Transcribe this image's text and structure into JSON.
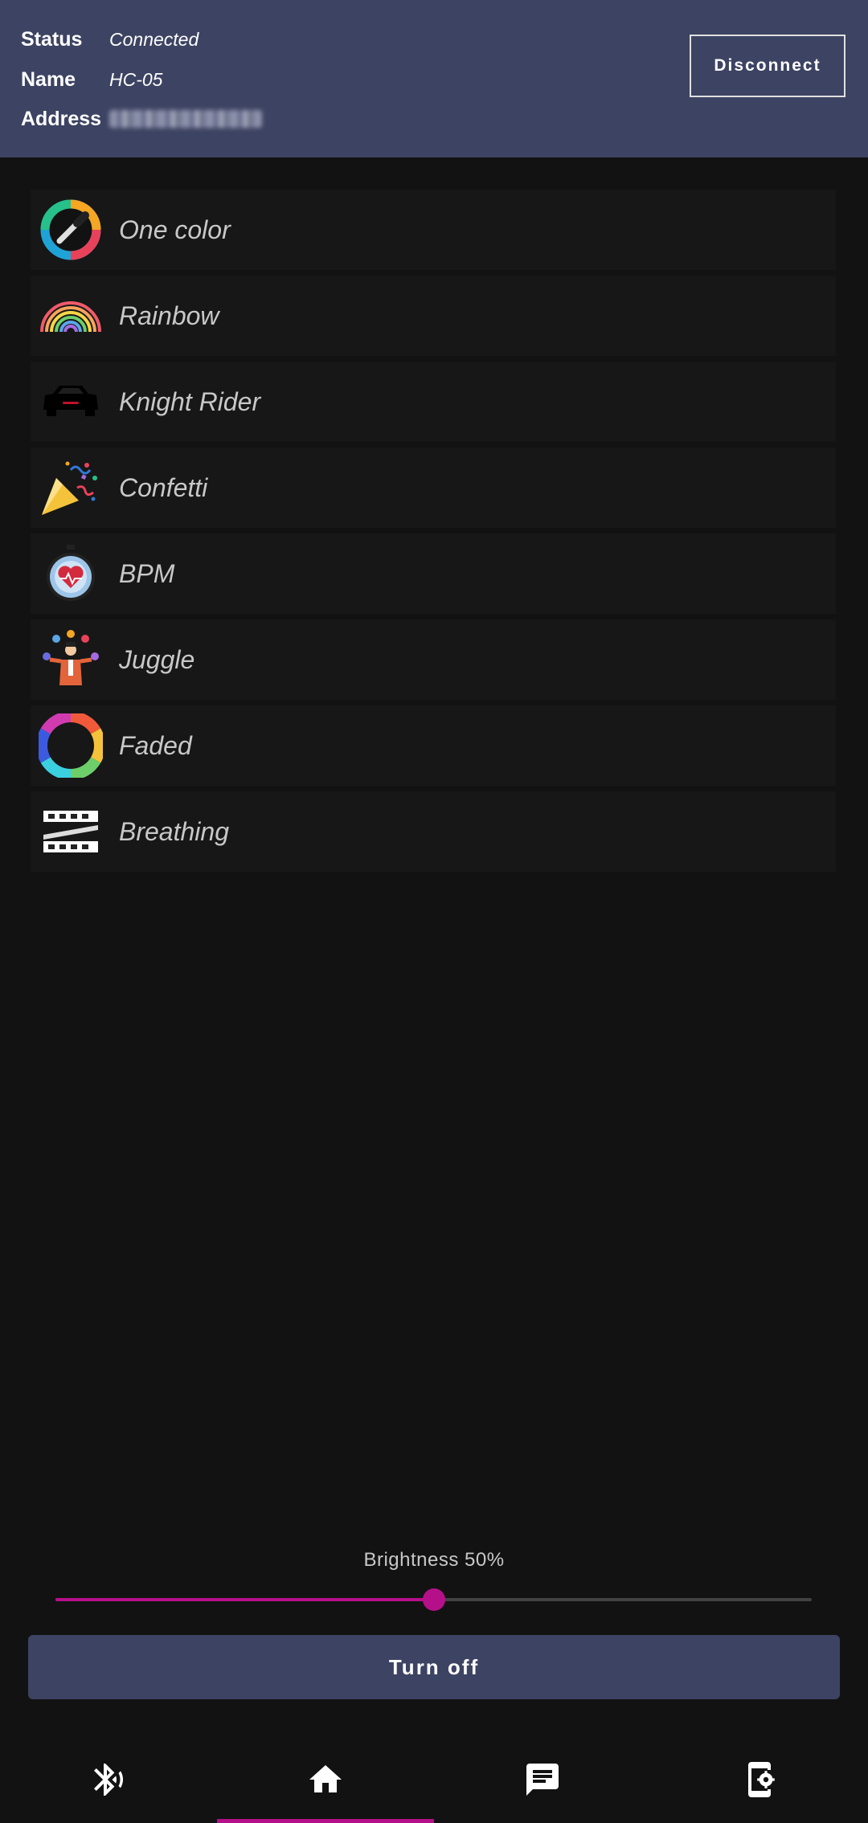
{
  "header": {
    "status_label": "Status",
    "status_value": "Connected",
    "name_label": "Name",
    "name_value": "HC-05",
    "address_label": "Address",
    "disconnect_label": "Disconnect"
  },
  "modes": [
    {
      "label": "One color",
      "icon": "color-picker-icon"
    },
    {
      "label": "Rainbow",
      "icon": "rainbow-icon"
    },
    {
      "label": "Knight Rider",
      "icon": "car-icon"
    },
    {
      "label": "Confetti",
      "icon": "party-popper-icon"
    },
    {
      "label": "BPM",
      "icon": "heart-stopwatch-icon"
    },
    {
      "label": "Juggle",
      "icon": "juggler-icon"
    },
    {
      "label": "Faded",
      "icon": "color-wheel-icon"
    },
    {
      "label": "Breathing",
      "icon": "led-strip-icon"
    }
  ],
  "brightness": {
    "label": "Brightness 50%",
    "value": 0.5
  },
  "turn_off_label": "Turn off",
  "nav": [
    {
      "icon": "bluetooth-icon",
      "active": false
    },
    {
      "icon": "home-icon",
      "active": true
    },
    {
      "icon": "message-icon",
      "active": false
    },
    {
      "icon": "device-settings-icon",
      "active": false
    }
  ],
  "colors": {
    "header_bg": "#3d4362",
    "accent": "#b5108a",
    "background": "#121212",
    "list_item_bg": "#171717"
  }
}
